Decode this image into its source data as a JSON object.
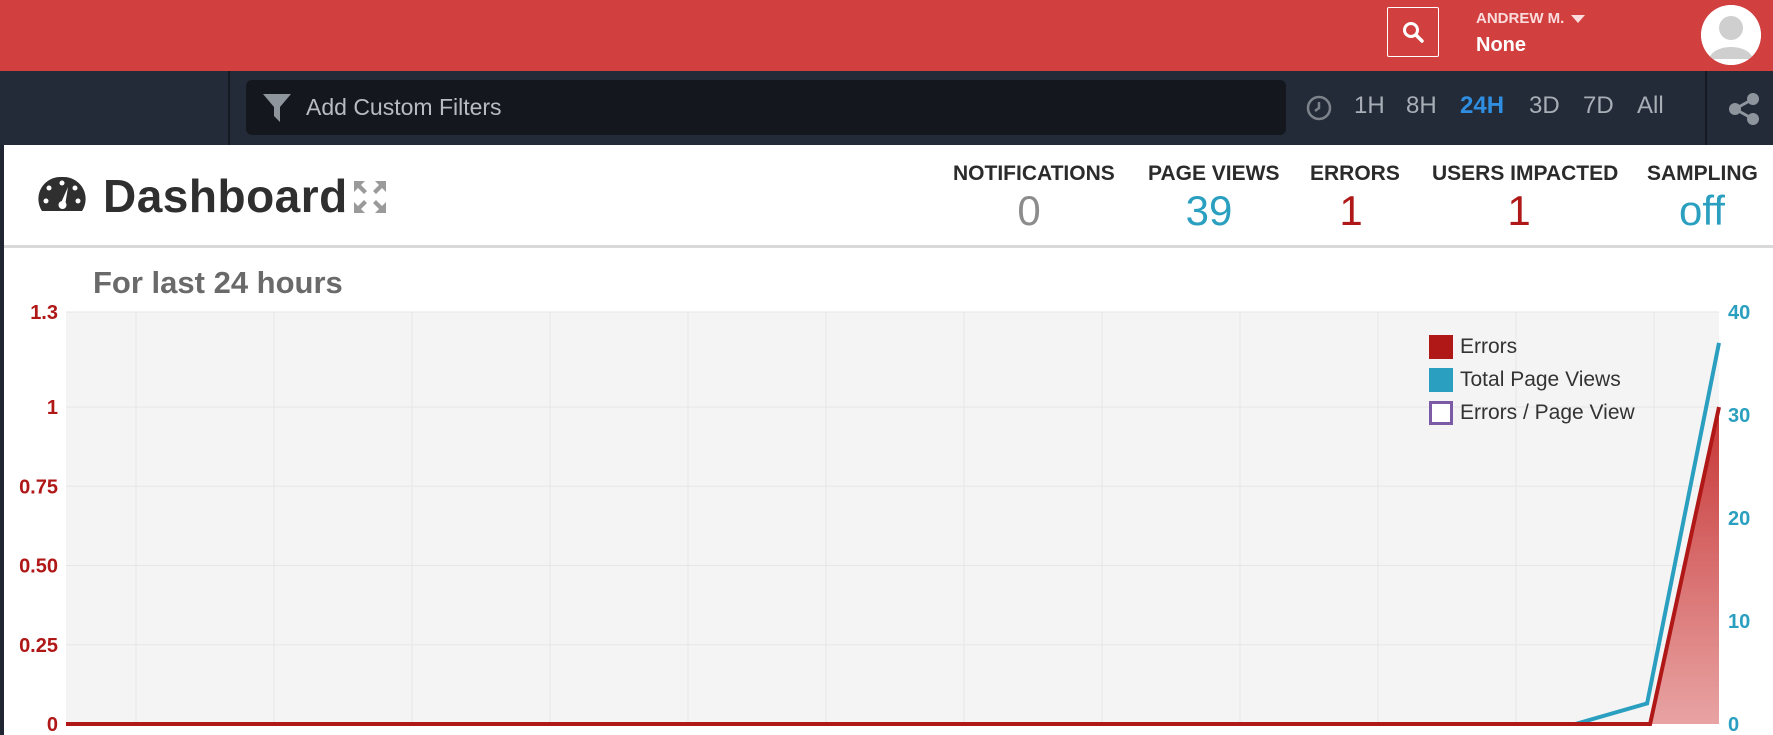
{
  "header": {
    "search_icon": "search-icon",
    "user_name": "ANDREW M.",
    "user_org": "None",
    "avatar_icon": "user-avatar-icon"
  },
  "filters": {
    "placeholder": "Add Custom Filters",
    "filter_icon": "funnel-icon",
    "ranges": [
      "1H",
      "8H",
      "24H",
      "3D",
      "7D",
      "All"
    ],
    "active_range": "24H"
  },
  "dashboard": {
    "title": "Dashboard",
    "stats": [
      {
        "label": "NOTIFICATIONS",
        "value": "0",
        "color": "#8c8c8c"
      },
      {
        "label": "PAGE VIEWS",
        "value": "39",
        "color": "#2a9fbf"
      },
      {
        "label": "ERRORS",
        "value": "1",
        "color": "#b01717"
      },
      {
        "label": "USERS IMPACTED",
        "value": "1",
        "color": "#b01717"
      },
      {
        "label": "SAMPLING",
        "value": "off",
        "color": "#2a9fbf"
      }
    ],
    "period": "For last 24 hours"
  },
  "colors": {
    "header_red": "#d13f3f",
    "filter_bar": "#232b38",
    "errors": "#b01717",
    "page_views": "#2a9fbf",
    "errors_per_view": "#7b5aa6",
    "active_range": "#2f8ee0"
  },
  "chart_data": {
    "type": "area",
    "legend_position": "top-right",
    "grid": true,
    "y_left": {
      "ticks": [
        "0",
        "0.25",
        "0.50",
        "0.75",
        "1",
        "1.3"
      ],
      "range": [
        0,
        1.3
      ]
    },
    "y_right": {
      "ticks": [
        "0",
        "10",
        "20",
        "30",
        "40"
      ],
      "range": [
        0,
        40
      ]
    },
    "series": [
      {
        "name": "Errors",
        "axis": "left",
        "values": [
          0,
          0,
          0,
          0,
          0,
          0,
          0,
          0,
          0,
          0,
          0,
          0,
          0,
          0,
          0,
          0,
          0,
          0,
          0,
          0,
          0,
          0,
          0,
          0,
          1
        ]
      },
      {
        "name": "Total Page Views",
        "axis": "right",
        "values": [
          0,
          0,
          0,
          0,
          0,
          0,
          0,
          0,
          0,
          0,
          0,
          0,
          0,
          0,
          0,
          0,
          0,
          0,
          0,
          0,
          0,
          0,
          2,
          37
        ]
      },
      {
        "name": "Errors / Page View",
        "axis": "left",
        "values": []
      }
    ]
  }
}
